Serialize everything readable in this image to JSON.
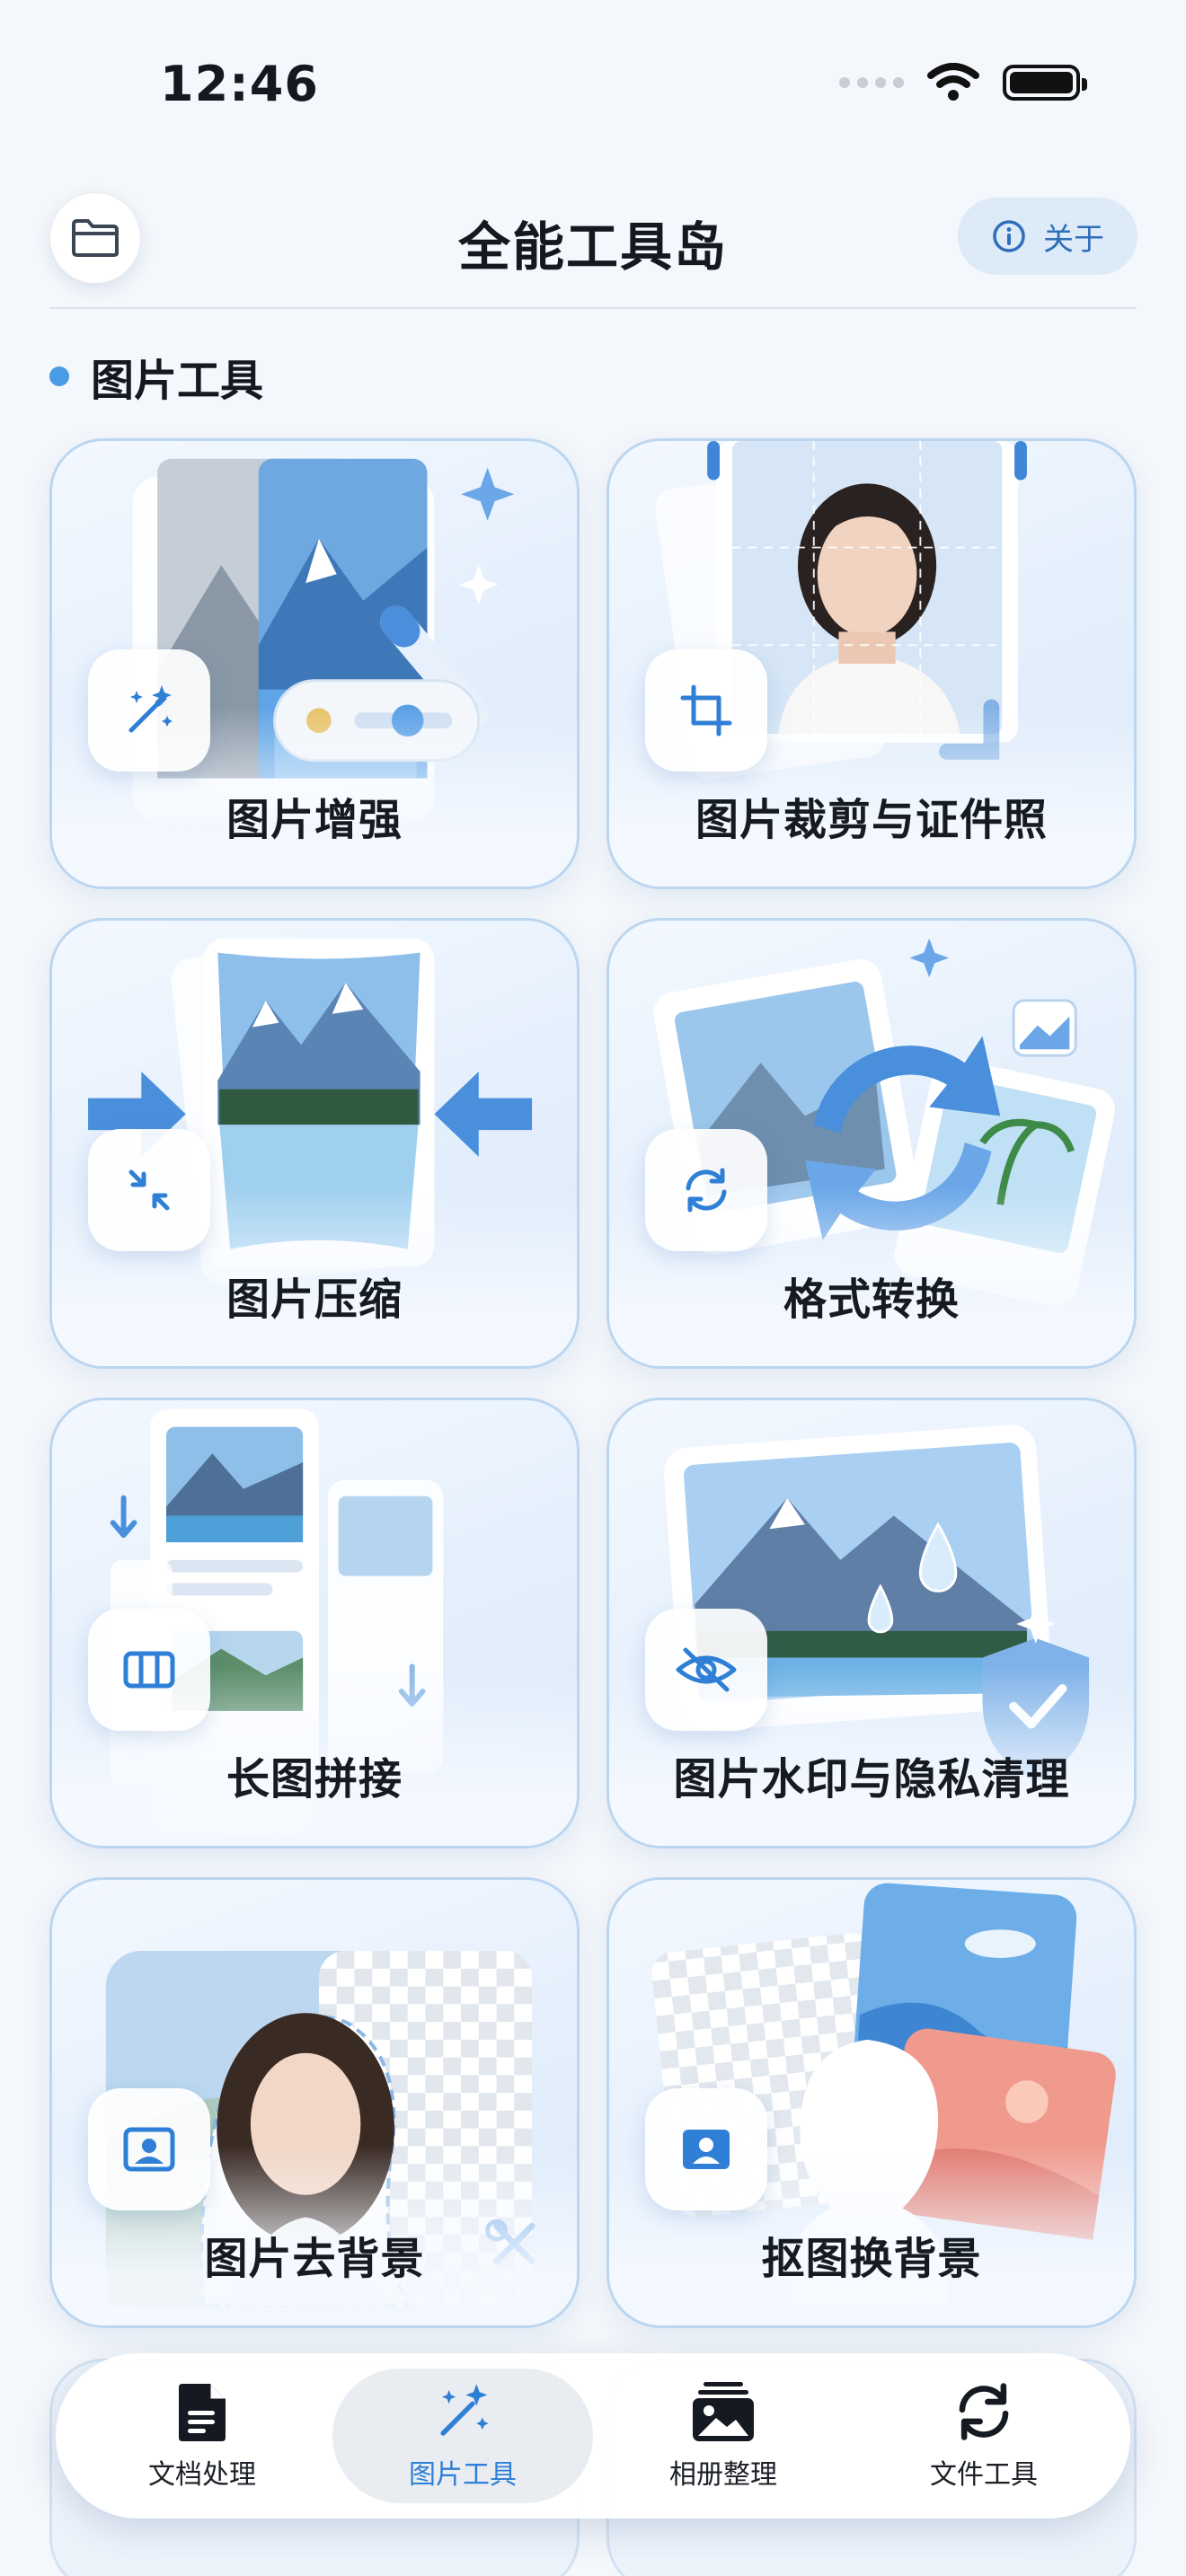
{
  "status_bar": {
    "time": "12:46"
  },
  "header": {
    "title": "全能工具岛",
    "about_label": "关于"
  },
  "section": {
    "title": "图片工具"
  },
  "tools": [
    {
      "label": "图片增强",
      "icon": "magic-wand-icon"
    },
    {
      "label": "图片裁剪与证件照",
      "icon": "crop-icon"
    },
    {
      "label": "图片压缩",
      "icon": "compress-arrows-icon"
    },
    {
      "label": "格式转换",
      "icon": "refresh-icon"
    },
    {
      "label": "长图拼接",
      "icon": "columns-icon"
    },
    {
      "label": "图片水印与隐私清理",
      "icon": "eye-off-icon"
    },
    {
      "label": "图片去背景",
      "icon": "portrait-frame-icon"
    },
    {
      "label": "抠图换背景",
      "icon": "person-badge-icon"
    }
  ],
  "tabbar": {
    "items": [
      {
        "label": "文档处理",
        "icon": "document-icon",
        "active": false
      },
      {
        "label": "图片工具",
        "icon": "magic-wand-icon",
        "active": true
      },
      {
        "label": "相册整理",
        "icon": "photo-stack-icon",
        "active": false
      },
      {
        "label": "文件工具",
        "icon": "sync-icon",
        "active": false
      }
    ]
  },
  "colors": {
    "accent": "#2f7fd6",
    "card_border": "#bcd6f0",
    "background": "#f4f7fb",
    "section_dot": "#4a9be6"
  }
}
